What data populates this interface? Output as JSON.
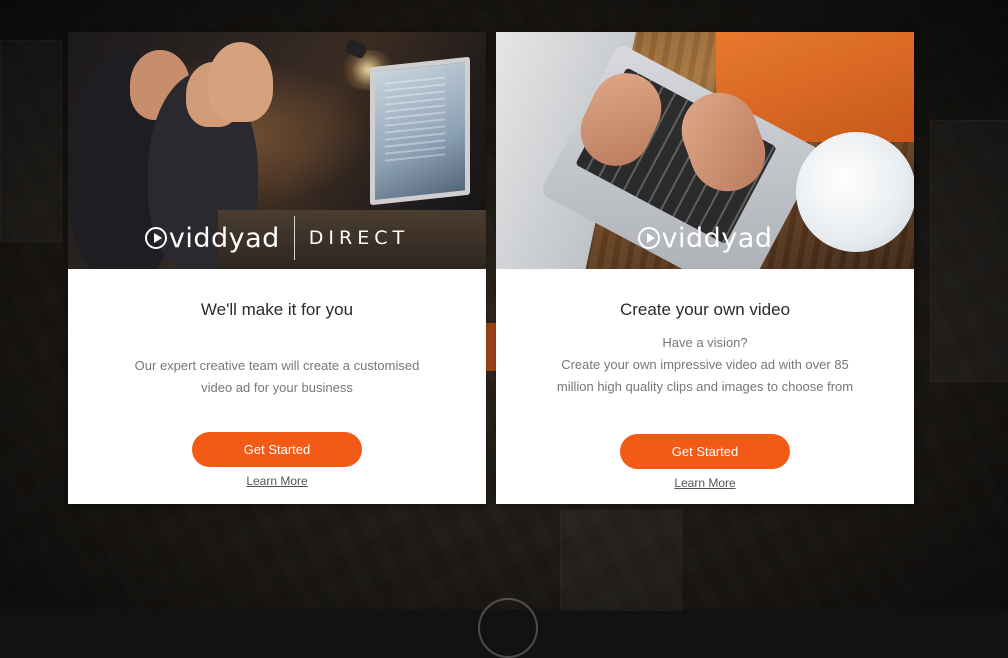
{
  "cards": [
    {
      "logo_brand": "viddyad",
      "logo_sub": "DIRECT",
      "title": "We'll make it for you",
      "description_lines": [
        "Our expert creative team will create a customised",
        "video ad for your business"
      ],
      "button_label": "Get Started",
      "link_label": "Learn More"
    },
    {
      "logo_brand": "viddyad",
      "title": "Create your own video",
      "description_lines": [
        "Have a vision?",
        "Create your own impressive video ad with over 85",
        "million high quality clips and images to choose from"
      ],
      "button_label": "Get Started",
      "link_label": "Learn More"
    }
  ],
  "colors": {
    "accent": "#f25a16",
    "card_bg": "#ffffff",
    "page_bg": "#1b1815"
  },
  "icons": [
    "play-circle-icon"
  ]
}
